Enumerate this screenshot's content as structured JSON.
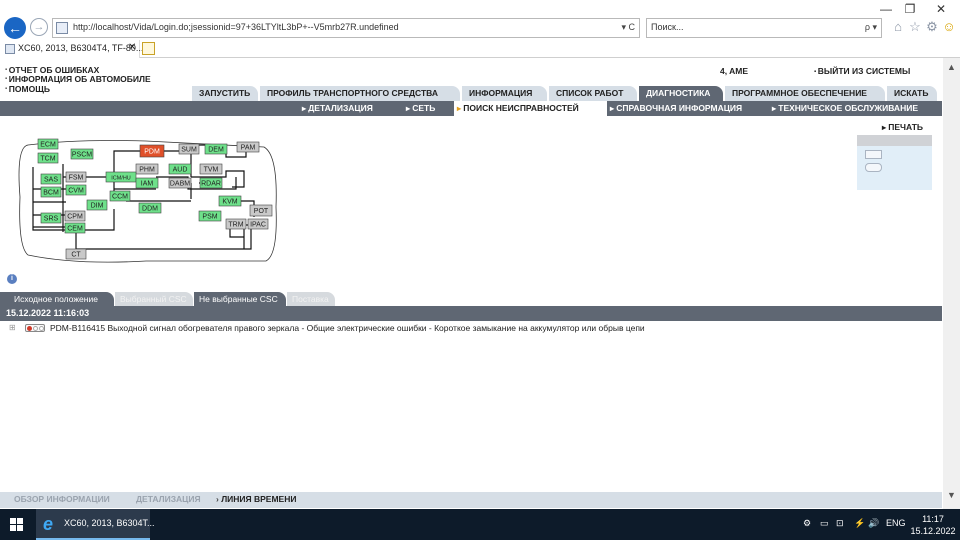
{
  "window": {
    "minimize": "—",
    "restore": "❐",
    "close": "✕"
  },
  "browser": {
    "url": "http://localhost/Vida/Login.do;jsessionid=97+36LTYltL3bP+--V5mrb27R.undefined",
    "url_controls": "▾ C",
    "search_placeholder": "Поиск...",
    "search_controls": "ρ ▾",
    "tab_title": "XC60, 2013, B6304T4, TF-80...",
    "tab_close": "✕",
    "icons": {
      "home": "⌂",
      "favorites": "☆",
      "settings": "⚙",
      "smiley": "☺"
    }
  },
  "app": {
    "left_menu": [
      "ОТЧЕТ ОБ ОШИБКАХ",
      "ИНФОРМАЦИЯ ОБ АВТОМОБИЛЕ",
      "ПОМОЩЬ"
    ],
    "user": "4, AME",
    "logout": "ВЫЙТИ ИЗ СИСТЕМЫ",
    "main_tabs": [
      {
        "label": "ЗАПУСТИТЬ"
      },
      {
        "label": "ПРОФИЛЬ ТРАНСПОРТНОГО СРЕДСТВА"
      },
      {
        "label": "ИНФОРМАЦИЯ"
      },
      {
        "label": "СПИСОК РАБОТ"
      },
      {
        "label": "ДИАГНОСТИКА"
      },
      {
        "label": "ПРОГРАММНОЕ ОБЕСПЕЧЕНИЕ"
      },
      {
        "label": "ИСКАТЬ"
      }
    ],
    "active_main_tab": "ДИАГНОСТИКА",
    "sub_tabs": [
      {
        "label": "ДЕТАЛИЗАЦИЯ"
      },
      {
        "label": "СЕТЬ"
      },
      {
        "label": "ПОИСК НЕИСПРАВНОСТЕЙ"
      },
      {
        "label": "СПРАВОЧНАЯ ИНФОРМАЦИЯ"
      },
      {
        "label": "ТЕХНИЧЕСКОЕ ОБСЛУЖИВАНИЕ"
      }
    ],
    "active_sub_tab": "ПОИСК НЕИСПРАВНОСТЕЙ",
    "print_label": "ПЕЧАТЬ",
    "info_icon": "i",
    "filter_tabs": [
      {
        "label": "Исходное положение"
      },
      {
        "label": "Выбранный CSC"
      },
      {
        "label": "Не выбранные CSC"
      },
      {
        "label": "Поставка"
      }
    ],
    "date": "15.12.2022 11:16:03",
    "dtc": {
      "expand": "⊞",
      "text": "PDM-B116415 Выходной сигнал обогревателя правого зеркала - Общие электрические ошибки - Короткое замыкание на аккумулятор или обрыв цепи"
    },
    "bottom_tabs": [
      {
        "label": "ОБЗОР ИНФОРМАЦИИ"
      },
      {
        "label": "ДЕТАЛИЗАЦИЯ"
      },
      {
        "label": "ЛИНИЯ ВРЕМЕНИ"
      }
    ],
    "network_modules": [
      {
        "name": "ECM",
        "state": "ok"
      },
      {
        "name": "TCM",
        "state": "ok"
      },
      {
        "name": "PSCM",
        "state": "ok"
      },
      {
        "name": "PDM",
        "state": "fault"
      },
      {
        "name": "SUM",
        "state": "inactive"
      },
      {
        "name": "DEM",
        "state": "ok"
      },
      {
        "name": "PAM",
        "state": "inactive"
      },
      {
        "name": "SAS",
        "state": "ok"
      },
      {
        "name": "FSM",
        "state": "inactive"
      },
      {
        "name": "PHM",
        "state": "inactive"
      },
      {
        "name": "AUD",
        "state": "ok"
      },
      {
        "name": "TVM",
        "state": "inactive"
      },
      {
        "name": "ICM/HU",
        "state": "ok"
      },
      {
        "name": "BCM",
        "state": "ok"
      },
      {
        "name": "CVM",
        "state": "ok"
      },
      {
        "name": "IAM",
        "state": "ok"
      },
      {
        "name": "DABM",
        "state": "inactive"
      },
      {
        "name": "RDAR",
        "state": "ok"
      },
      {
        "name": "CCM",
        "state": "ok"
      },
      {
        "name": "PSM",
        "state": "ok"
      },
      {
        "name": "DIM",
        "state": "ok"
      },
      {
        "name": "DDM",
        "state": "ok"
      },
      {
        "name": "KVM",
        "state": "ok"
      },
      {
        "name": "SRS",
        "state": "ok"
      },
      {
        "name": "CPM",
        "state": "inactive"
      },
      {
        "name": "POT",
        "state": "inactive"
      },
      {
        "name": "CEM",
        "state": "ok"
      },
      {
        "name": "TRM",
        "state": "inactive"
      },
      {
        "name": "IPAC",
        "state": "inactive"
      },
      {
        "name": "CT",
        "state": "inactive"
      }
    ],
    "colors": {
      "ok": "#6ee08a",
      "fault": "#e0502a",
      "inactive": "#c9c9c9",
      "tab_active": "#5f6773",
      "tab_inactive": "#d6dee6"
    }
  },
  "taskbar": {
    "app_label": "XC60, 2013, B6304T...",
    "ie_glyph": "e",
    "tray_items": [
      "⚙",
      "▭",
      "⊡",
      "⚡",
      "🔊",
      "ENG"
    ],
    "time": "11:17",
    "date": "15.12.2022"
  }
}
